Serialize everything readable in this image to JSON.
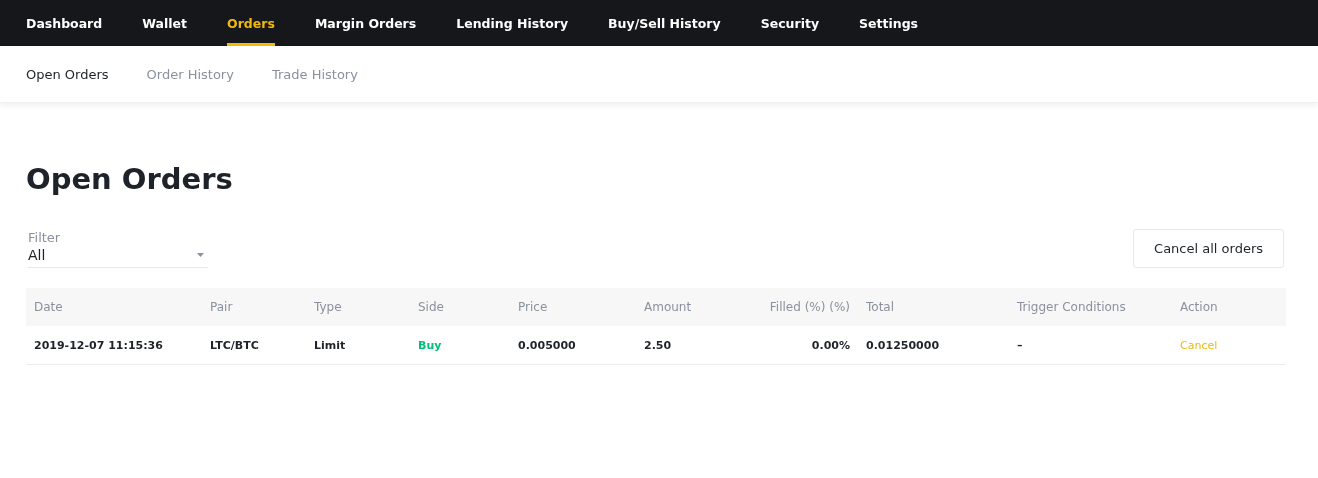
{
  "top_nav": [
    {
      "label": "Dashboard",
      "selected": false
    },
    {
      "label": "Wallet",
      "selected": false
    },
    {
      "label": "Orders",
      "selected": true
    },
    {
      "label": "Margin Orders",
      "selected": false
    },
    {
      "label": "Lending History",
      "selected": false
    },
    {
      "label": "Buy/Sell History",
      "selected": false
    },
    {
      "label": "Security",
      "selected": false
    },
    {
      "label": "Settings",
      "selected": false
    }
  ],
  "sub_nav": [
    {
      "label": "Open Orders",
      "selected": true
    },
    {
      "label": "Order History",
      "selected": false
    },
    {
      "label": "Trade History",
      "selected": false
    }
  ],
  "title": "Open Orders",
  "filter": {
    "label": "Filter",
    "value": "All"
  },
  "cancel_all_button": "Cancel all orders",
  "table": {
    "columns": [
      "Date",
      "Pair",
      "Type",
      "Side",
      "Price",
      "Amount",
      "Filled (%) (%)",
      "Total",
      "Trigger Conditions",
      "Action"
    ],
    "rows": [
      [
        {
          "kind": "text",
          "text": "2019-12-07 11:15:36"
        },
        {
          "kind": "text",
          "text": "LTC/BTC"
        },
        {
          "kind": "text",
          "text": "Limit"
        },
        {
          "kind": "buy",
          "text": "Buy"
        },
        {
          "kind": "text",
          "text": "0.005000"
        },
        {
          "kind": "text",
          "text": "2.50"
        },
        {
          "kind": "text",
          "text": "0.00%"
        },
        {
          "kind": "text",
          "text": "0.01250000"
        },
        {
          "kind": "text",
          "text": "–"
        },
        {
          "kind": "link",
          "text": "Cancel"
        }
      ]
    ]
  }
}
